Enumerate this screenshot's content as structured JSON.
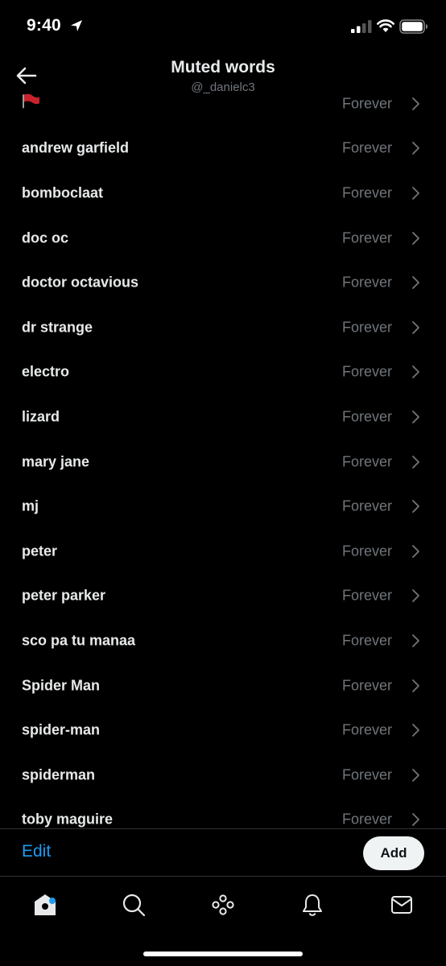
{
  "status_bar": {
    "time": "9:40"
  },
  "header": {
    "title": "Muted words",
    "subtitle": "@_danielc3",
    "back_icon": "arrow-left-icon"
  },
  "muted_words": [
    {
      "word": "",
      "icon": "red-flag-icon",
      "duration": "Forever"
    },
    {
      "word": "andrew garfield",
      "duration": "Forever"
    },
    {
      "word": "bomboclaat",
      "duration": "Forever"
    },
    {
      "word": "doc oc",
      "duration": "Forever"
    },
    {
      "word": "doctor octavious",
      "duration": "Forever"
    },
    {
      "word": "dr strange",
      "duration": "Forever"
    },
    {
      "word": "electro",
      "duration": "Forever"
    },
    {
      "word": "lizard",
      "duration": "Forever"
    },
    {
      "word": "mary jane",
      "duration": "Forever"
    },
    {
      "word": "mj",
      "duration": "Forever"
    },
    {
      "word": "peter",
      "duration": "Forever"
    },
    {
      "word": "peter parker",
      "duration": "Forever"
    },
    {
      "word": "sco pa tu manaa",
      "duration": "Forever"
    },
    {
      "word": "Spider Man",
      "duration": "Forever"
    },
    {
      "word": "spider-man",
      "duration": "Forever"
    },
    {
      "word": "spiderman",
      "duration": "Forever"
    },
    {
      "word": "toby maguire",
      "duration": "Forever"
    }
  ],
  "action_bar": {
    "edit_label": "Edit",
    "add_label": "Add"
  },
  "tab_bar": {
    "tabs": [
      {
        "icon": "home-icon",
        "has_notification_dot": true
      },
      {
        "icon": "search-icon"
      },
      {
        "icon": "spaces-icon"
      },
      {
        "icon": "bell-icon"
      },
      {
        "icon": "mail-icon"
      }
    ]
  },
  "colors": {
    "background": "#000000",
    "primary_text": "#e7e9ea",
    "secondary_text": "#71767b",
    "accent": "#1d9bf0",
    "divider": "#2f3336",
    "flag": "#c8232c"
  }
}
